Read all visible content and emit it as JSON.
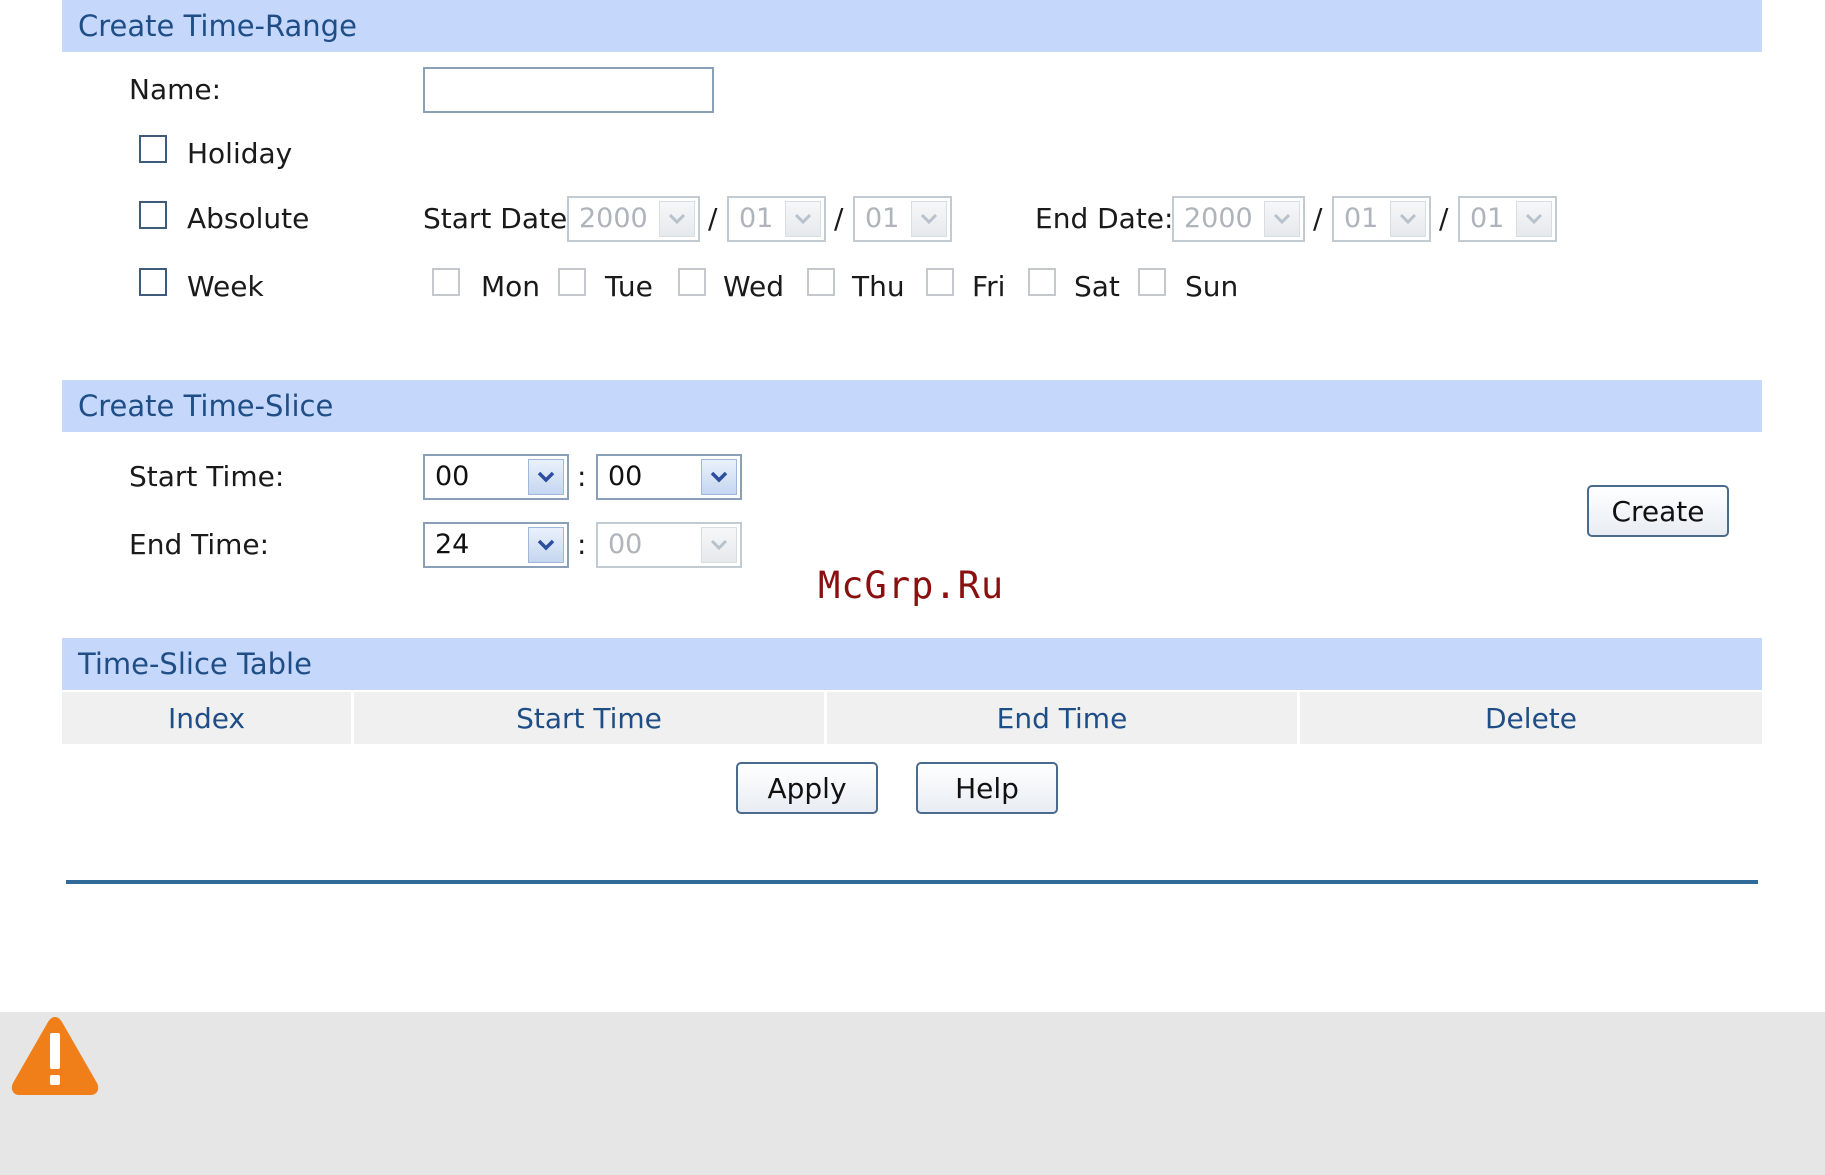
{
  "time_range": {
    "header": "Create Time-Range",
    "name_label": "Name:",
    "name_value": "",
    "holiday_label": "Holiday",
    "absolute_label": "Absolute",
    "week_label": "Week",
    "start_date_label": "Start Date:",
    "end_date_label": "End Date:",
    "date_sep": "/",
    "start_date": {
      "year": "2000",
      "month": "01",
      "day": "01"
    },
    "end_date": {
      "year": "2000",
      "month": "01",
      "day": "01"
    },
    "days": [
      "Mon",
      "Tue",
      "Wed",
      "Thu",
      "Fri",
      "Sat",
      "Sun"
    ]
  },
  "time_slice": {
    "header": "Create Time-Slice",
    "start_label": "Start Time:",
    "end_label": "End Time:",
    "time_sep": ":",
    "start_hour": "00",
    "start_minute": "00",
    "end_hour": "24",
    "end_minute": "00",
    "create_label": "Create"
  },
  "table": {
    "header": "Time-Slice Table",
    "columns": [
      "Index",
      "Start Time",
      "End Time",
      "Delete"
    ]
  },
  "buttons": {
    "apply": "Apply",
    "help": "Help"
  },
  "watermark": "McGrp.Ru",
  "colors": {
    "section_header_bg": "#c5d7fb",
    "section_header_text": "#1f4e86",
    "rule": "#2f6a99",
    "warning": "#f07f1a"
  },
  "icons": {
    "warning": "warning-triangle-icon"
  }
}
